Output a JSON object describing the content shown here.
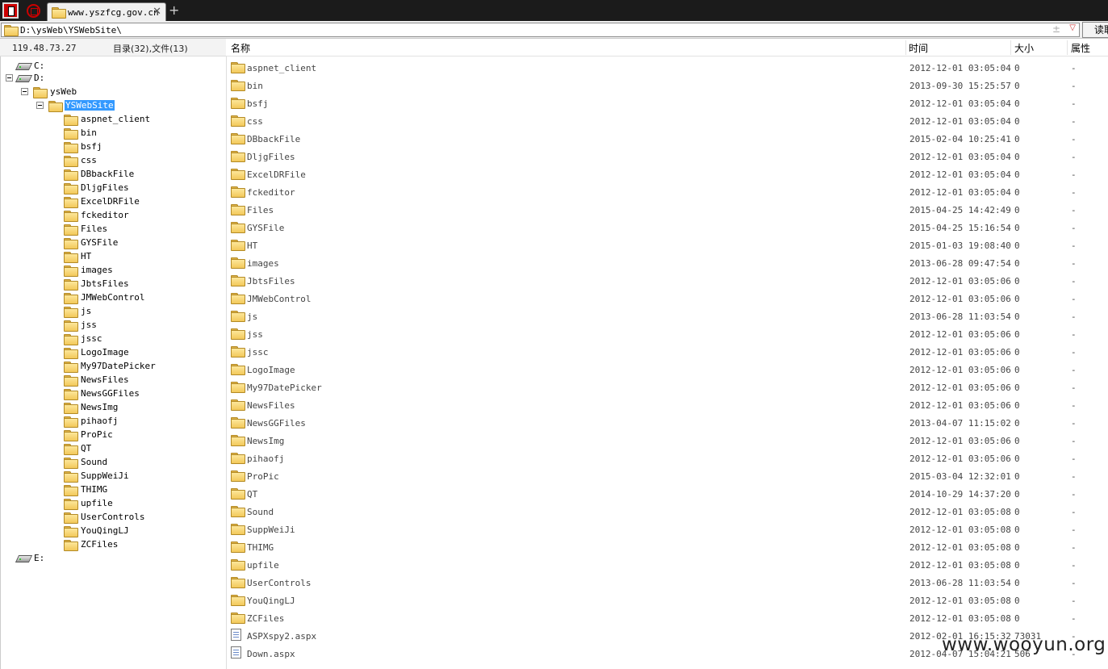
{
  "tab": {
    "title": "www.yszfcg.gov.cn",
    "close": "✕",
    "new_tab": "+"
  },
  "address": {
    "path": "D:\\ysWeb\\YSWebSite\\",
    "plus_minus": "±",
    "dropdown": "▽",
    "read_button": "读取"
  },
  "left_header": {
    "ip": "119.48.73.27",
    "counts": "目录(32),文件(13)"
  },
  "tree": {
    "drives": [
      "C:",
      "D:",
      "E:"
    ],
    "ysweb": "ysWeb",
    "selected": "YSWebSite",
    "children": [
      "aspnet_client",
      "bin",
      "bsfj",
      "css",
      "DBbackFile",
      "DljgFiles",
      "ExcelDRFile",
      "fckeditor",
      "Files",
      "GYSFile",
      "HT",
      "images",
      "JbtsFiles",
      "JMWebControl",
      "js",
      "jss",
      "jssc",
      "LogoImage",
      "My97DatePicker",
      "NewsFiles",
      "NewsGGFiles",
      "NewsImg",
      "pihaofj",
      "ProPic",
      "QT",
      "Sound",
      "SuppWeiJi",
      "THIMG",
      "upfile",
      "UserControls",
      "YouQingLJ",
      "ZCFiles"
    ]
  },
  "columns": {
    "name": "名称",
    "time": "时间",
    "size": "大小",
    "attr": "属性"
  },
  "rows": [
    {
      "name": "aspnet_client",
      "time": "2012-12-01 03:05:04",
      "size": "0",
      "attr": "-",
      "type": "folder"
    },
    {
      "name": "bin",
      "time": "2013-09-30 15:25:57",
      "size": "0",
      "attr": "-",
      "type": "folder"
    },
    {
      "name": "bsfj",
      "time": "2012-12-01 03:05:04",
      "size": "0",
      "attr": "-",
      "type": "folder"
    },
    {
      "name": "css",
      "time": "2012-12-01 03:05:04",
      "size": "0",
      "attr": "-",
      "type": "folder"
    },
    {
      "name": "DBbackFile",
      "time": "2015-02-04 10:25:41",
      "size": "0",
      "attr": "-",
      "type": "folder"
    },
    {
      "name": "DljgFiles",
      "time": "2012-12-01 03:05:04",
      "size": "0",
      "attr": "-",
      "type": "folder"
    },
    {
      "name": "ExcelDRFile",
      "time": "2012-12-01 03:05:04",
      "size": "0",
      "attr": "-",
      "type": "folder"
    },
    {
      "name": "fckeditor",
      "time": "2012-12-01 03:05:04",
      "size": "0",
      "attr": "-",
      "type": "folder"
    },
    {
      "name": "Files",
      "time": "2015-04-25 14:42:49",
      "size": "0",
      "attr": "-",
      "type": "folder"
    },
    {
      "name": "GYSFile",
      "time": "2015-04-25 15:16:54",
      "size": "0",
      "attr": "-",
      "type": "folder"
    },
    {
      "name": "HT",
      "time": "2015-01-03 19:08:40",
      "size": "0",
      "attr": "-",
      "type": "folder"
    },
    {
      "name": "images",
      "time": "2013-06-28 09:47:54",
      "size": "0",
      "attr": "-",
      "type": "folder"
    },
    {
      "name": "JbtsFiles",
      "time": "2012-12-01 03:05:06",
      "size": "0",
      "attr": "-",
      "type": "folder"
    },
    {
      "name": "JMWebControl",
      "time": "2012-12-01 03:05:06",
      "size": "0",
      "attr": "-",
      "type": "folder"
    },
    {
      "name": "js",
      "time": "2013-06-28 11:03:54",
      "size": "0",
      "attr": "-",
      "type": "folder"
    },
    {
      "name": "jss",
      "time": "2012-12-01 03:05:06",
      "size": "0",
      "attr": "-",
      "type": "folder"
    },
    {
      "name": "jssc",
      "time": "2012-12-01 03:05:06",
      "size": "0",
      "attr": "-",
      "type": "folder"
    },
    {
      "name": "LogoImage",
      "time": "2012-12-01 03:05:06",
      "size": "0",
      "attr": "-",
      "type": "folder"
    },
    {
      "name": "My97DatePicker",
      "time": "2012-12-01 03:05:06",
      "size": "0",
      "attr": "-",
      "type": "folder"
    },
    {
      "name": "NewsFiles",
      "time": "2012-12-01 03:05:06",
      "size": "0",
      "attr": "-",
      "type": "folder"
    },
    {
      "name": "NewsGGFiles",
      "time": "2013-04-07 11:15:02",
      "size": "0",
      "attr": "-",
      "type": "folder"
    },
    {
      "name": "NewsImg",
      "time": "2012-12-01 03:05:06",
      "size": "0",
      "attr": "-",
      "type": "folder"
    },
    {
      "name": "pihaofj",
      "time": "2012-12-01 03:05:06",
      "size": "0",
      "attr": "-",
      "type": "folder"
    },
    {
      "name": "ProPic",
      "time": "2015-03-04 12:32:01",
      "size": "0",
      "attr": "-",
      "type": "folder"
    },
    {
      "name": "QT",
      "time": "2014-10-29 14:37:20",
      "size": "0",
      "attr": "-",
      "type": "folder"
    },
    {
      "name": "Sound",
      "time": "2012-12-01 03:05:08",
      "size": "0",
      "attr": "-",
      "type": "folder"
    },
    {
      "name": "SuppWeiJi",
      "time": "2012-12-01 03:05:08",
      "size": "0",
      "attr": "-",
      "type": "folder"
    },
    {
      "name": "THIMG",
      "time": "2012-12-01 03:05:08",
      "size": "0",
      "attr": "-",
      "type": "folder"
    },
    {
      "name": "upfile",
      "time": "2012-12-01 03:05:08",
      "size": "0",
      "attr": "-",
      "type": "folder"
    },
    {
      "name": "UserControls",
      "time": "2013-06-28 11:03:54",
      "size": "0",
      "attr": "-",
      "type": "folder"
    },
    {
      "name": "YouQingLJ",
      "time": "2012-12-01 03:05:08",
      "size": "0",
      "attr": "-",
      "type": "folder"
    },
    {
      "name": "ZCFiles",
      "time": "2012-12-01 03:05:08",
      "size": "0",
      "attr": "-",
      "type": "folder"
    },
    {
      "name": "ASPXspy2.aspx",
      "time": "2012-02-01 16:15:32",
      "size": "73031",
      "attr": "-",
      "type": "file"
    },
    {
      "name": "Down.aspx",
      "time": "2012-04-07 15:04:21",
      "size": "506",
      "attr": "-",
      "type": "file"
    }
  ],
  "watermark": "www.wooyun.org"
}
